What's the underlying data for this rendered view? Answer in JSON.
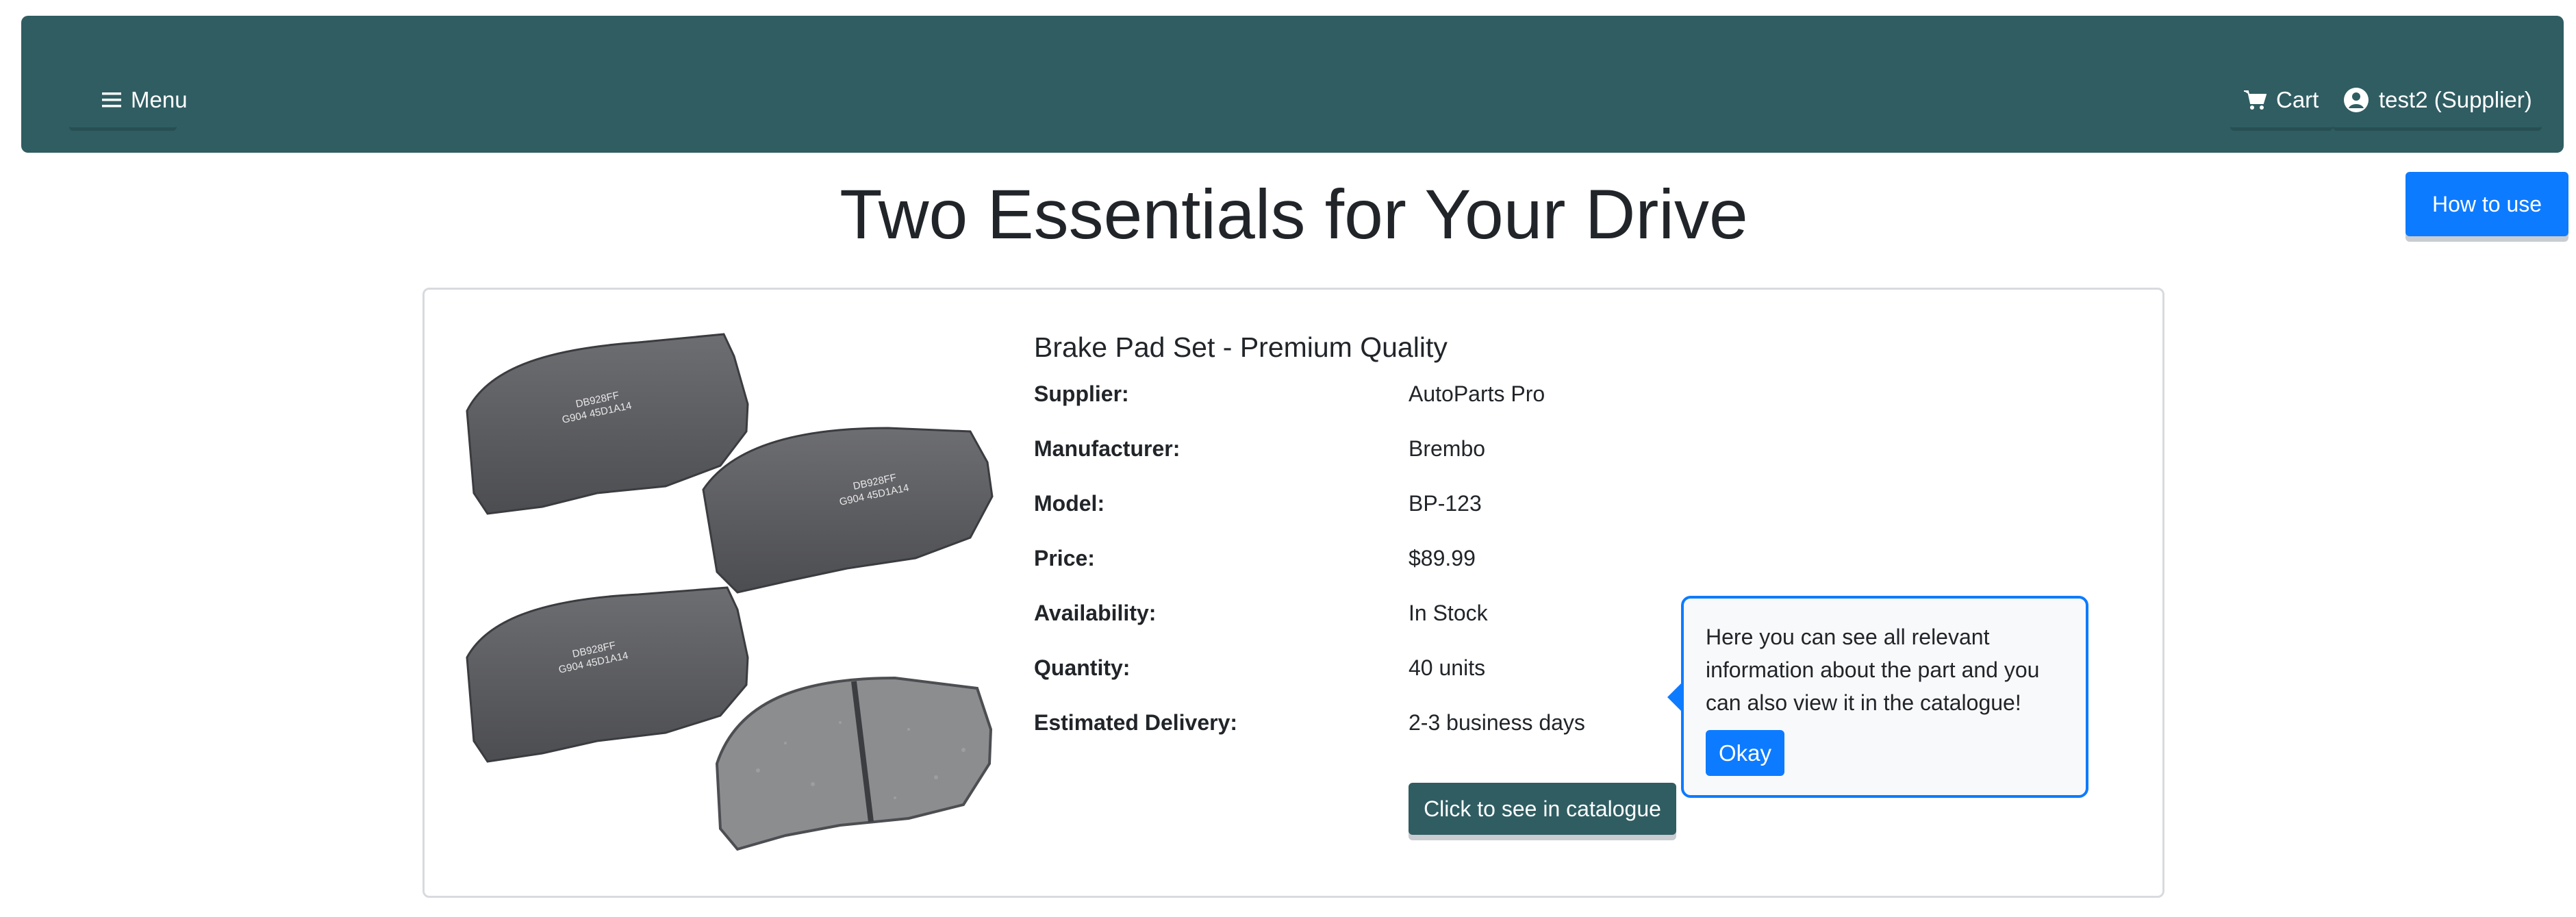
{
  "navbar": {
    "menu_label": "Menu",
    "cart_label": "Cart",
    "user_label": "test2 (Supplier)",
    "background": "#2f5d62"
  },
  "how_to_use_label": "How to use",
  "page_title": "Two Essentials for Your Drive",
  "product": {
    "title": "Brake Pad Set - Premium Quality",
    "image_pad_text": [
      "DB928FF",
      "G904 45D1A14"
    ],
    "specs": [
      {
        "label": "Supplier:",
        "value": "AutoParts Pro"
      },
      {
        "label": "Manufacturer:",
        "value": "Brembo"
      },
      {
        "label": "Model:",
        "value": "BP-123"
      },
      {
        "label": "Price:",
        "value": "$89.99"
      },
      {
        "label": "Availability:",
        "value": "In Stock"
      },
      {
        "label": "Quantity:",
        "value": "40 units"
      },
      {
        "label": "Estimated Delivery:",
        "value": "2-3 business days"
      }
    ],
    "catalogue_button_label": "Click to see in catalogue"
  },
  "tooltip": {
    "text": "Here you can see all relevant information about the part and you can also view it in the catalogue!",
    "okay_label": "Okay"
  },
  "colors": {
    "primary": "#0d7bff",
    "teal": "#2f5d62"
  }
}
